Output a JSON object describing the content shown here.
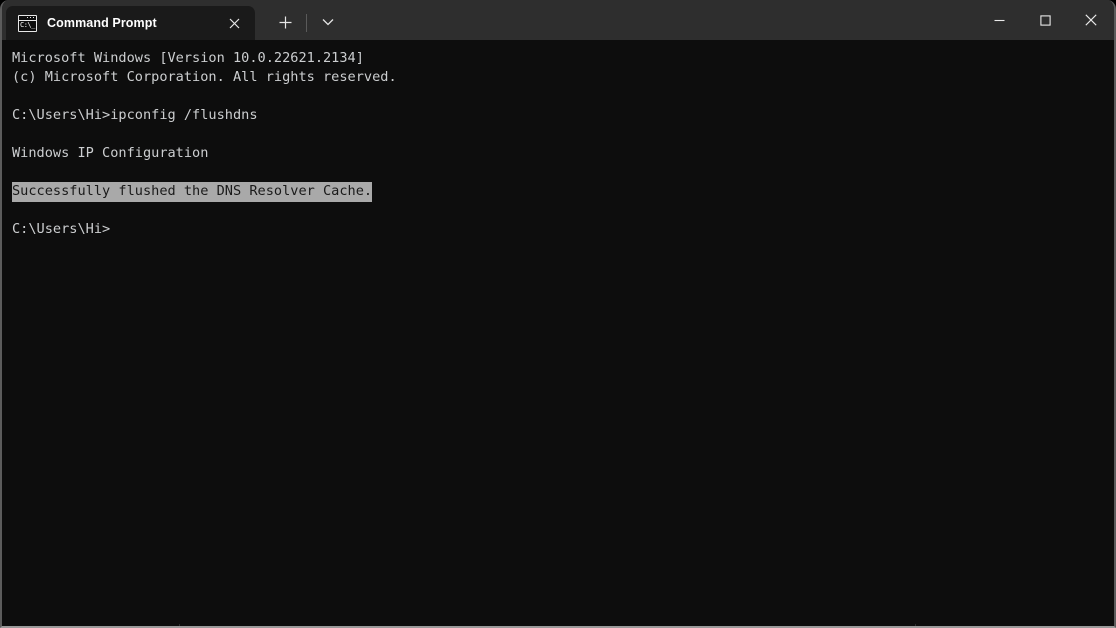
{
  "window": {
    "title": "Command Prompt",
    "colors": {
      "tabstrip_background": "#2e2e2e",
      "active_tab_background": "#1a1a1a",
      "terminal_background": "#0d0d0d",
      "terminal_foreground": "#ccced0",
      "selection_background": "#a9a9a9",
      "selection_foreground": "#1a1a1a",
      "window_border": "#5c5c5c"
    }
  },
  "tab": {
    "label": "Command Prompt",
    "icon": "cmd-prompt-icon",
    "icon_glyph": "C:\\_",
    "close_icon": "close-icon",
    "close_glyph": "✕"
  },
  "tabstrip": {
    "new_tab_icon": "plus-icon",
    "new_tab_glyph": "+",
    "dropdown_icon": "chevron-down-icon",
    "dropdown_glyph": "∨"
  },
  "caption_buttons": {
    "minimize": {
      "icon": "minimize-icon",
      "glyph": "─"
    },
    "maximize": {
      "icon": "maximize-icon",
      "glyph": "□"
    },
    "close": {
      "icon": "close-icon",
      "glyph": "✕"
    }
  },
  "terminal": {
    "lines": [
      {
        "text": "Microsoft Windows [Version 10.0.22621.2134]",
        "selected": false
      },
      {
        "text": "(c) Microsoft Corporation. All rights reserved.",
        "selected": false
      },
      {
        "text": "",
        "selected": false
      },
      {
        "text": "C:\\Users\\Hi>ipconfig /flushdns",
        "selected": false
      },
      {
        "text": "",
        "selected": false
      },
      {
        "text": "Windows IP Configuration",
        "selected": false
      },
      {
        "text": "",
        "selected": false
      },
      {
        "text": "Successfully flushed the DNS Resolver Cache.",
        "selected": true
      },
      {
        "text": "",
        "selected": false
      },
      {
        "text": "C:\\Users\\Hi>",
        "selected": false
      }
    ],
    "prompt": "C:\\Users\\Hi>",
    "command": "ipconfig /flushdns"
  }
}
